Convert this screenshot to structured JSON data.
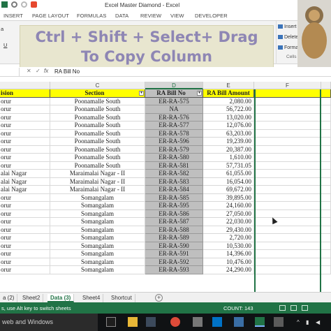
{
  "window": {
    "title": "Excel Master Diamond - Excel"
  },
  "ribbon_tabs": [
    "INSERT",
    "PAGE LAYOUT",
    "FORMULAS",
    "DATA",
    "REVIEW",
    "VIEW",
    "DEVELOPER"
  ],
  "ribbon": {
    "font_box_fragment": "a",
    "underline_button": "U",
    "cells_group": {
      "insert": "Insert",
      "delete": "Delete",
      "format": "Format",
      "label": "Cells"
    }
  },
  "banner": {
    "line1": "Ctrl + Shift + Select+ Drag",
    "line2": "To Copy Column"
  },
  "formula_bar": {
    "cancel_symbol": "✕",
    "enter_symbol": "✓",
    "fx_label": "fx",
    "value": "RA Bill No"
  },
  "columns": [
    "C",
    "D",
    "E",
    "F"
  ],
  "table": {
    "headers": [
      "ision",
      "Section",
      "RA Bill No",
      "RA Bill Amount"
    ],
    "rows": [
      [
        "orur",
        "Poonamalle South",
        "ER-RA-575",
        "2,080.00"
      ],
      [
        "orur",
        "Poonamalle South",
        "NA",
        "56,722.00"
      ],
      [
        "orur",
        "Poonamalle South",
        "ER-RA-576",
        "13,020.00"
      ],
      [
        "orur",
        "Poonamalle South",
        "ER-RA-577",
        "12,076.00"
      ],
      [
        "orur",
        "Poonamalle South",
        "ER-RA-578",
        "63,203.00"
      ],
      [
        "orur",
        "Poonamalle South",
        "ER-RA-596",
        "19,239.00"
      ],
      [
        "orur",
        "Poonamalle South",
        "ER-RA-579",
        "20,387.00"
      ],
      [
        "orur",
        "Poonamalle South",
        "ER-RA-580",
        "1,610.00"
      ],
      [
        "orur",
        "Poonamalle South",
        "ER-RA-581",
        "57,731.05"
      ],
      [
        "alai Nagar",
        "Maraimalai Nagar - II",
        "ER-RA-582",
        "61,055.00"
      ],
      [
        "alai Nagar",
        "Maraimalai Nagar - II",
        "ER-RA-583",
        "16,054.00"
      ],
      [
        "alai Nagar",
        "Maraimalai Nagar - II",
        "ER-RA-584",
        "69,672.00"
      ],
      [
        "orur",
        "Somangalam",
        "ER-RA-585",
        "39,895.00"
      ],
      [
        "orur",
        "Somangalam",
        "ER-RA-595",
        "24,160.00"
      ],
      [
        "orur",
        "Somangalam",
        "ER-RA-586",
        "27,050.00"
      ],
      [
        "orur",
        "Somangalam",
        "ER-RA-587",
        "22,030.00"
      ],
      [
        "orur",
        "Somangalam",
        "ER-RA-588",
        "29,430.00"
      ],
      [
        "orur",
        "Somangalam",
        "ER-RA-589",
        "2,720.00"
      ],
      [
        "orur",
        "Somangalam",
        "ER-RA-590",
        "10,530.00"
      ],
      [
        "orur",
        "Somangalam",
        "ER-RA-591",
        "14,396.00"
      ],
      [
        "orur",
        "Somangalam",
        "ER-RA-592",
        "10,476.00"
      ],
      [
        "orur",
        "Somangalam",
        "ER-RA-593",
        "24,290.00"
      ]
    ]
  },
  "sheet_tabs": [
    {
      "label": "a (2)",
      "active": false
    },
    {
      "label": "Sheet2",
      "active": false
    },
    {
      "label": "Data (3)",
      "active": true
    },
    {
      "label": "Sheet4",
      "active": false
    },
    {
      "label": "Shortcut",
      "active": false
    }
  ],
  "add_sheet_symbol": "+",
  "status_bar": {
    "message": "s, use Alt key to switch sheets",
    "count": "COUNT: 143"
  },
  "taskbar": {
    "search_text": "web and Windows"
  },
  "colors": {
    "excel_green": "#217346",
    "header_yellow": "#ffff00",
    "selected_column_gray": "#bfbfbf",
    "banner_text": "#8e86b4",
    "banner_bg": "#e8e6cf"
  }
}
